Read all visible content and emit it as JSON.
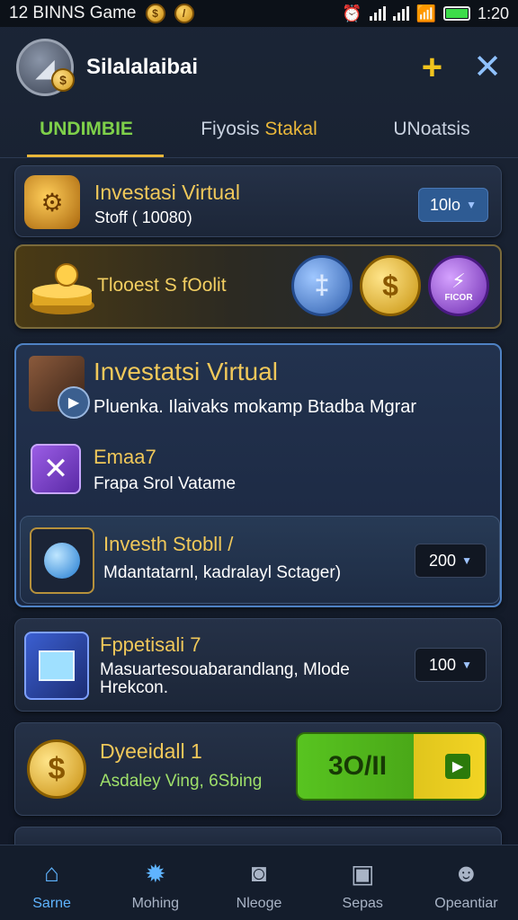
{
  "status_bar": {
    "app_label": "12 BINNS Game",
    "time": "1:20"
  },
  "header": {
    "title": "Silalalaibai"
  },
  "tabs": [
    {
      "label": "UNDIMBIE"
    },
    {
      "label_a": "Fiyosis",
      "label_b": "Stakal"
    },
    {
      "label": "UNoatsis"
    }
  ],
  "cards": {
    "invest1": {
      "title": "Investasi Virtual",
      "sub": "Stoff ( 10080)",
      "dropdown": "10lo"
    },
    "promo": {
      "text": "Tlooest S fOolit",
      "coins": [
        "coin-blue",
        "coin-gold",
        "coin-purple"
      ],
      "coin3_label": "FICOR"
    },
    "invest2": {
      "title": "Investatsi Virtual",
      "sub": "Pluenka. Ilaivaks mokamp Btadba Mgrar",
      "item2_title": "Emaa7",
      "item2_sub": "Frapa Srol Vatame",
      "item3_title": "Investh Stobll /",
      "item3_sub": "Mdantatarnl, kadralayl Sctager)",
      "item3_dropdown": "200"
    },
    "fppetisali": {
      "title": "Fppetisali 7",
      "sub1": "Masuartesouabarandlang, Mlode",
      "sub2": "Hrekcon.",
      "dropdown": "100"
    },
    "dyeeidall": {
      "title": "Dyeeidall 1",
      "sub": "Asdaley Ving, 6Sbing",
      "button": "3O/II"
    }
  },
  "bottom_nav": [
    {
      "label": "Sarne",
      "icon": "home-icon"
    },
    {
      "label": "Mohing",
      "icon": "gear-sun-icon"
    },
    {
      "label": "Nleoge",
      "icon": "camera-icon"
    },
    {
      "label": "Sepas",
      "icon": "inbox-icon"
    },
    {
      "label": "Opeantiar",
      "icon": "profile-icon"
    }
  ],
  "colors": {
    "accent_gold": "#f0c85a",
    "accent_green": "#7ed04a",
    "accent_blue": "#5fb4ff"
  }
}
